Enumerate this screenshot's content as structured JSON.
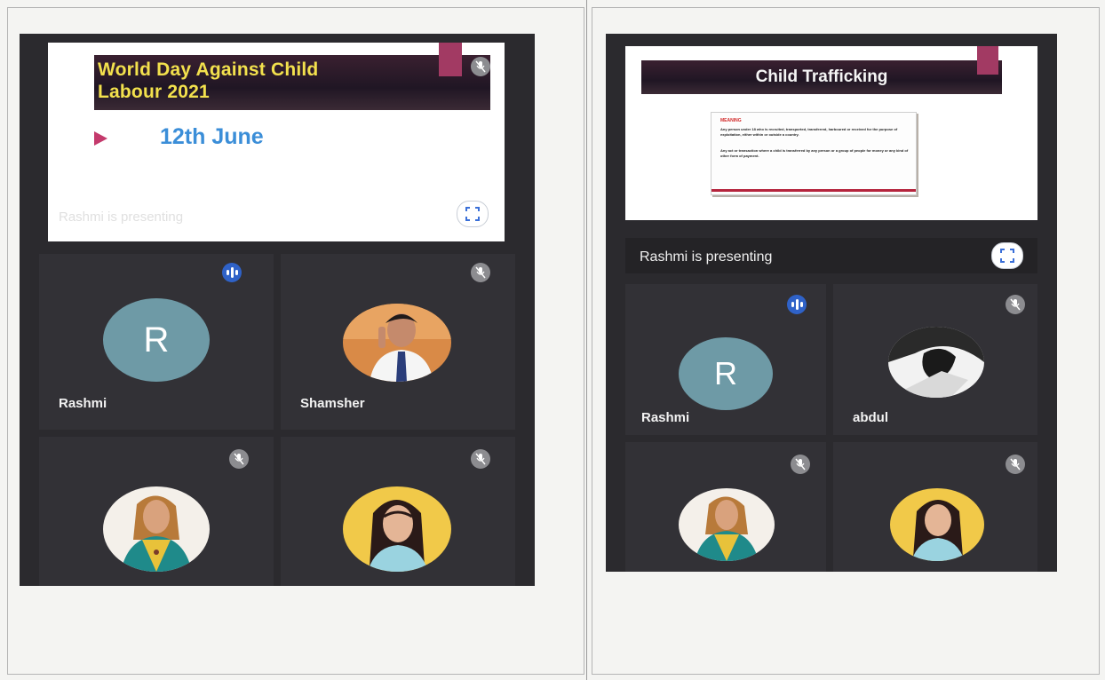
{
  "left_screenshot": {
    "slide": {
      "title_line1": "World Day Against Child",
      "title_line2": "Labour 2021",
      "date": "12th June",
      "presenting_label": "Rashmi is presenting"
    },
    "participants": [
      {
        "name": "Rashmi",
        "initial": "R",
        "avatar": "letter",
        "status": "speaking-icon"
      },
      {
        "name": "Shamsher",
        "avatar": "photo",
        "status": "mic-muted-icon"
      },
      {
        "name": "",
        "avatar": "photo",
        "status": "mic-muted-icon"
      },
      {
        "name": "",
        "avatar": "photo",
        "status": "mic-muted-icon"
      }
    ]
  },
  "right_screenshot": {
    "slide": {
      "title": "Child Trafficking",
      "meaning_heading": "MEANING",
      "meaning_para1": "Any person under 18 who is recruited, transported, transferred, harboured or received for the purpose of exploitation, either within or outside a country.",
      "meaning_para2": "Any act or transaction where a child is transferred by any person or a group of people for money or any kind of other form of payment."
    },
    "presenting_label": "Rashmi is presenting",
    "participants": [
      {
        "name": "Rashmi",
        "initial": "R",
        "avatar": "letter",
        "status": "speaking-icon"
      },
      {
        "name": "abdul",
        "avatar": "photo",
        "status": "mic-muted-icon"
      },
      {
        "name": "",
        "avatar": "photo",
        "status": "mic-muted-icon"
      },
      {
        "name": "",
        "avatar": "photo",
        "status": "mic-muted-icon"
      }
    ]
  },
  "colors": {
    "meeting_background": "#2b2a2e",
    "avatar_letter_bg": "#6e9aa6",
    "speaking_indicator": "#2f62c8",
    "slide_title_yellow": "#f3e14d",
    "slide_date_blue": "#3b8ed8"
  }
}
